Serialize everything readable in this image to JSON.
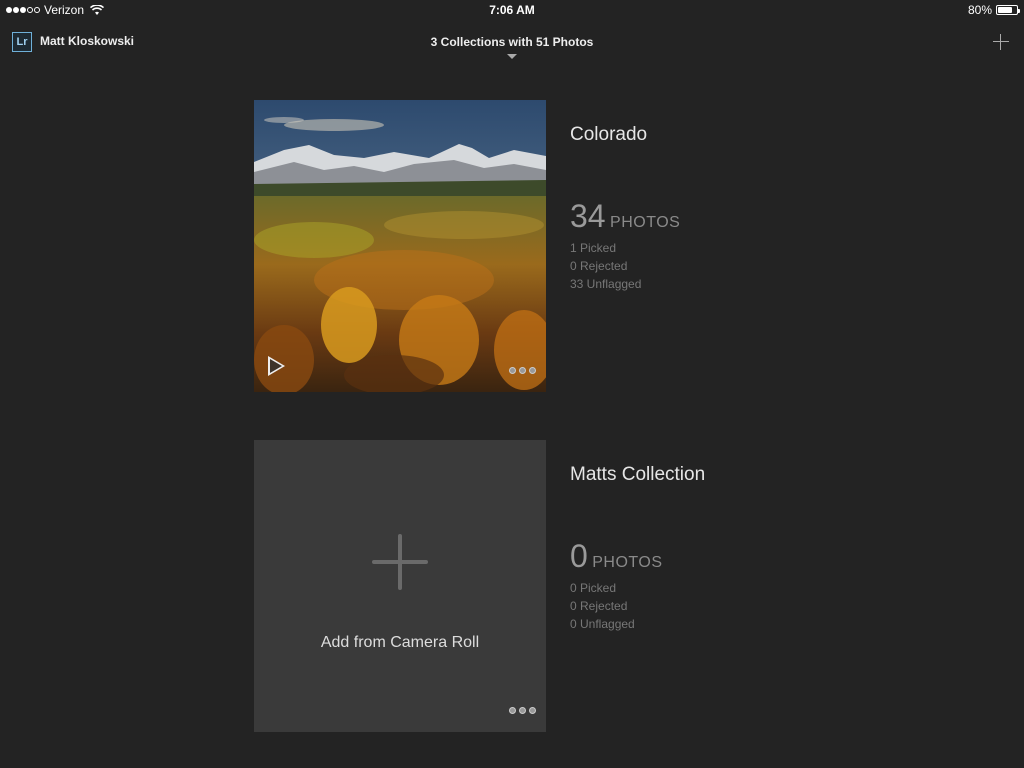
{
  "status_bar": {
    "carrier": "Verizon",
    "time": "7:06 AM",
    "battery": "80%",
    "battery_level": 0.8,
    "signal_bars_filled": 3,
    "signal_bars_total": 5
  },
  "nav": {
    "app_badge": "Lr",
    "user_name": "Matt Kloskowski",
    "title": "3 Collections with 51 Photos"
  },
  "collections": [
    {
      "name": "Colorado",
      "count": "34",
      "unit": "PHOTOS",
      "picked": "1 Picked",
      "rejected": "0 Rejected",
      "unflagged": "33 Unflagged"
    },
    {
      "name": "Matts Collection",
      "count": "0",
      "unit": "PHOTOS",
      "picked": "0 Picked",
      "rejected": "0 Rejected",
      "unflagged": "0 Unflagged",
      "add_label": "Add from Camera Roll"
    }
  ],
  "colors": {
    "background": "#232323",
    "badge_accent": "#6fb0d8",
    "empty_tile": "#3a3a3a"
  }
}
